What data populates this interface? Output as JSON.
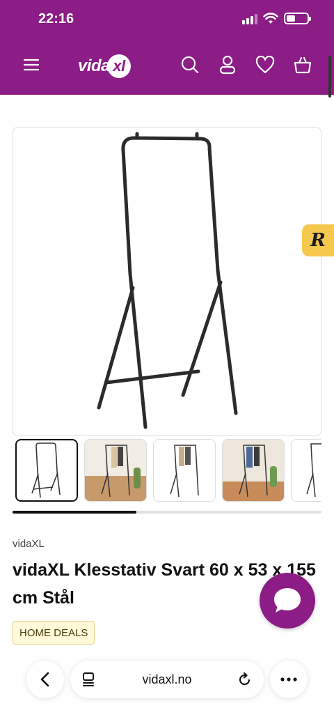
{
  "status_bar": {
    "time": "22:16"
  },
  "header": {
    "logo_text": "vida",
    "logo_mark": "xl",
    "icons": [
      "menu-icon",
      "search-icon",
      "account-icon",
      "heart-icon",
      "basket-icon"
    ]
  },
  "peek_text": "",
  "reviews_badge": {
    "letter": "R"
  },
  "gallery": {
    "progress": 0.4
  },
  "product": {
    "brand": "vidaXL",
    "title": "vidaXL Klesstativ Svart 60 x 53 x 155 cm Stål",
    "badge": "HOME DEALS"
  },
  "browser": {
    "url": "vidaxl.no"
  },
  "colors": {
    "brand_purple": "#8c1c86",
    "badge_bg": "#fff8d9",
    "reviews_yellow": "#f6c84d"
  }
}
